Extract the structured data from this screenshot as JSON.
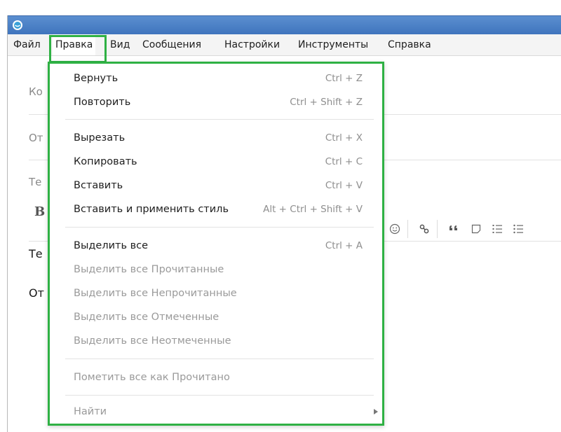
{
  "menubar": {
    "items": [
      "Файл",
      "Правка",
      "Вид",
      "Сообщения",
      "Настройки",
      "Инструменты",
      "Справка"
    ],
    "active_index": 1
  },
  "form": {
    "to_label": "Ко",
    "from_label": "От",
    "subject_label": "Те",
    "bold_label": "B",
    "body_line1": "Те",
    "body_line2": "От"
  },
  "edit_menu": {
    "items": [
      {
        "label": "Вернуть",
        "shortcut": "Ctrl + Z",
        "enabled": true
      },
      {
        "label": "Повторить",
        "shortcut": "Ctrl + Shift + Z",
        "enabled": true
      },
      {
        "label": "Вырезать",
        "shortcut": "Ctrl + X",
        "enabled": true
      },
      {
        "label": "Копировать",
        "shortcut": "Ctrl + C",
        "enabled": true
      },
      {
        "label": "Вставить",
        "shortcut": "Ctrl + V",
        "enabled": true
      },
      {
        "label": "Вставить и применить стиль",
        "shortcut": "Alt + Ctrl + Shift + V",
        "enabled": true
      },
      {
        "label": "Выделить все",
        "shortcut": "Ctrl + A",
        "enabled": true
      },
      {
        "label": "Выделить все Прочитанные",
        "shortcut": "",
        "enabled": false
      },
      {
        "label": "Выделить все Непрочитанные",
        "shortcut": "",
        "enabled": false
      },
      {
        "label": "Выделить все Отмеченные",
        "shortcut": "",
        "enabled": false
      },
      {
        "label": "Выделить все Неотмеченные",
        "shortcut": "",
        "enabled": false
      },
      {
        "label": "Пометить все как Прочитано",
        "shortcut": "",
        "enabled": false
      },
      {
        "label": "Найти",
        "shortcut": "",
        "enabled": false,
        "submenu": true
      }
    ]
  },
  "colors": {
    "highlight": "#2fb144",
    "titlebar": "#4a80c6"
  },
  "icons": {
    "app": "app-logo-icon",
    "toolbar": [
      "emoji-icon",
      "link-icon",
      "quote-icon",
      "note-icon",
      "ordered-list-icon",
      "bullet-list-icon"
    ]
  }
}
